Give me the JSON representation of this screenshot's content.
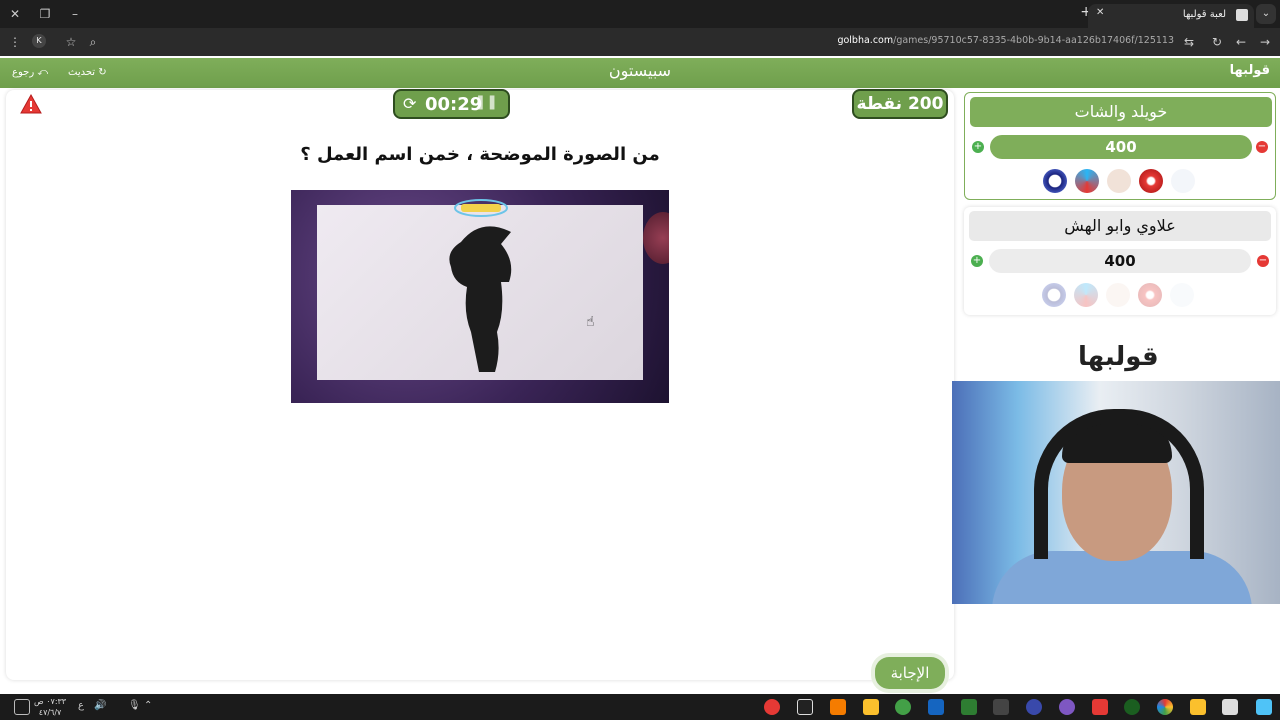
{
  "browser": {
    "tab_title": "لعبة قولبها",
    "url_host": "golbha.com",
    "url_path": "/games/95710c57-8335-4b0b-9b14-aa126b17406f/125113",
    "profile_initial": "K"
  },
  "header": {
    "title": "سبيستون",
    "back_label": "رجوع",
    "refresh_label": "تحديث",
    "logo_text": "قولبها"
  },
  "game": {
    "timer": "00:29",
    "points": "200 نقطة",
    "question": "من الصورة الموضحة ، خمن اسم العمل ؟",
    "answer_label": "الإجابة"
  },
  "teams": [
    {
      "name": "خويلد والشات",
      "score": "400",
      "active": true
    },
    {
      "name": "علاوي وابو الهش",
      "score": "400",
      "active": false
    }
  ],
  "brand_logo": "قولبها",
  "taskbar": {
    "time": "٠٧:٣٣ ص",
    "date": "٤٧/٦/٧",
    "lang": "ع"
  },
  "colors": {
    "accent_green": "#7fae5a",
    "dark_green_border": "#2e4d1f",
    "plus_green": "#4caf50",
    "minus_red": "#e53935"
  }
}
